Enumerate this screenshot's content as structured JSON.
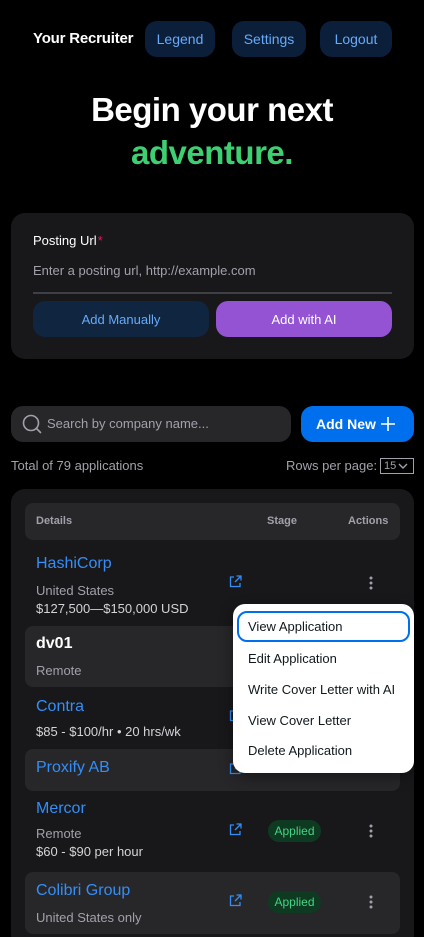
{
  "nav": {
    "brand": "Your Recruiter",
    "legend": "Legend",
    "settings": "Settings",
    "logout": "Logout"
  },
  "hero": {
    "line1": "Begin your next",
    "line2": "adventure."
  },
  "posting": {
    "label": "Posting Url",
    "required_mark": "*",
    "placeholder": "Enter a posting url, http://example.com",
    "add_manually": "Add Manually",
    "add_with_ai": "Add with AI"
  },
  "search": {
    "placeholder": "Search by company name...",
    "add_new": "Add New"
  },
  "summary": {
    "total": "Total of 79 applications",
    "rows_per_page_label": "Rows per page:",
    "rows_per_page_value": "15"
  },
  "table": {
    "headers": {
      "details": "Details",
      "stage": "Stage",
      "actions": "Actions"
    },
    "rows": [
      {
        "company": "HashiCorp",
        "line1": "United States",
        "line2": "$127,500—$150,000 USD",
        "stage": ""
      },
      {
        "company": "dv01",
        "line1": "Remote",
        "line2": "",
        "stage": ""
      },
      {
        "company": "Contra",
        "line1": "$85 - $100/hr • 20 hrs/wk",
        "line2": "",
        "stage": ""
      },
      {
        "company": "Proxify AB",
        "line1": "",
        "line2": "",
        "stage": ""
      },
      {
        "company": "Mercor",
        "line1": "Remote",
        "line2": "$60 - $90 per hour",
        "stage": "Applied"
      },
      {
        "company": "Colibri Group",
        "line1": "United States only",
        "line2": "",
        "stage": "Applied"
      }
    ]
  },
  "menu": {
    "items": [
      "View Application",
      "Edit Application",
      "Write Cover Letter with AI",
      "View Cover Letter",
      "Delete Application"
    ]
  },
  "colors": {
    "accent_blue": "#006fee",
    "link_blue": "#338ef7",
    "hero_green": "#3ecf72",
    "ai_purple": "#9353d3",
    "badge_green": "#45d483"
  },
  "icons": [
    "search-icon",
    "plus-icon",
    "chevron-down-icon",
    "external-link-icon",
    "kebab-menu-icon"
  ]
}
